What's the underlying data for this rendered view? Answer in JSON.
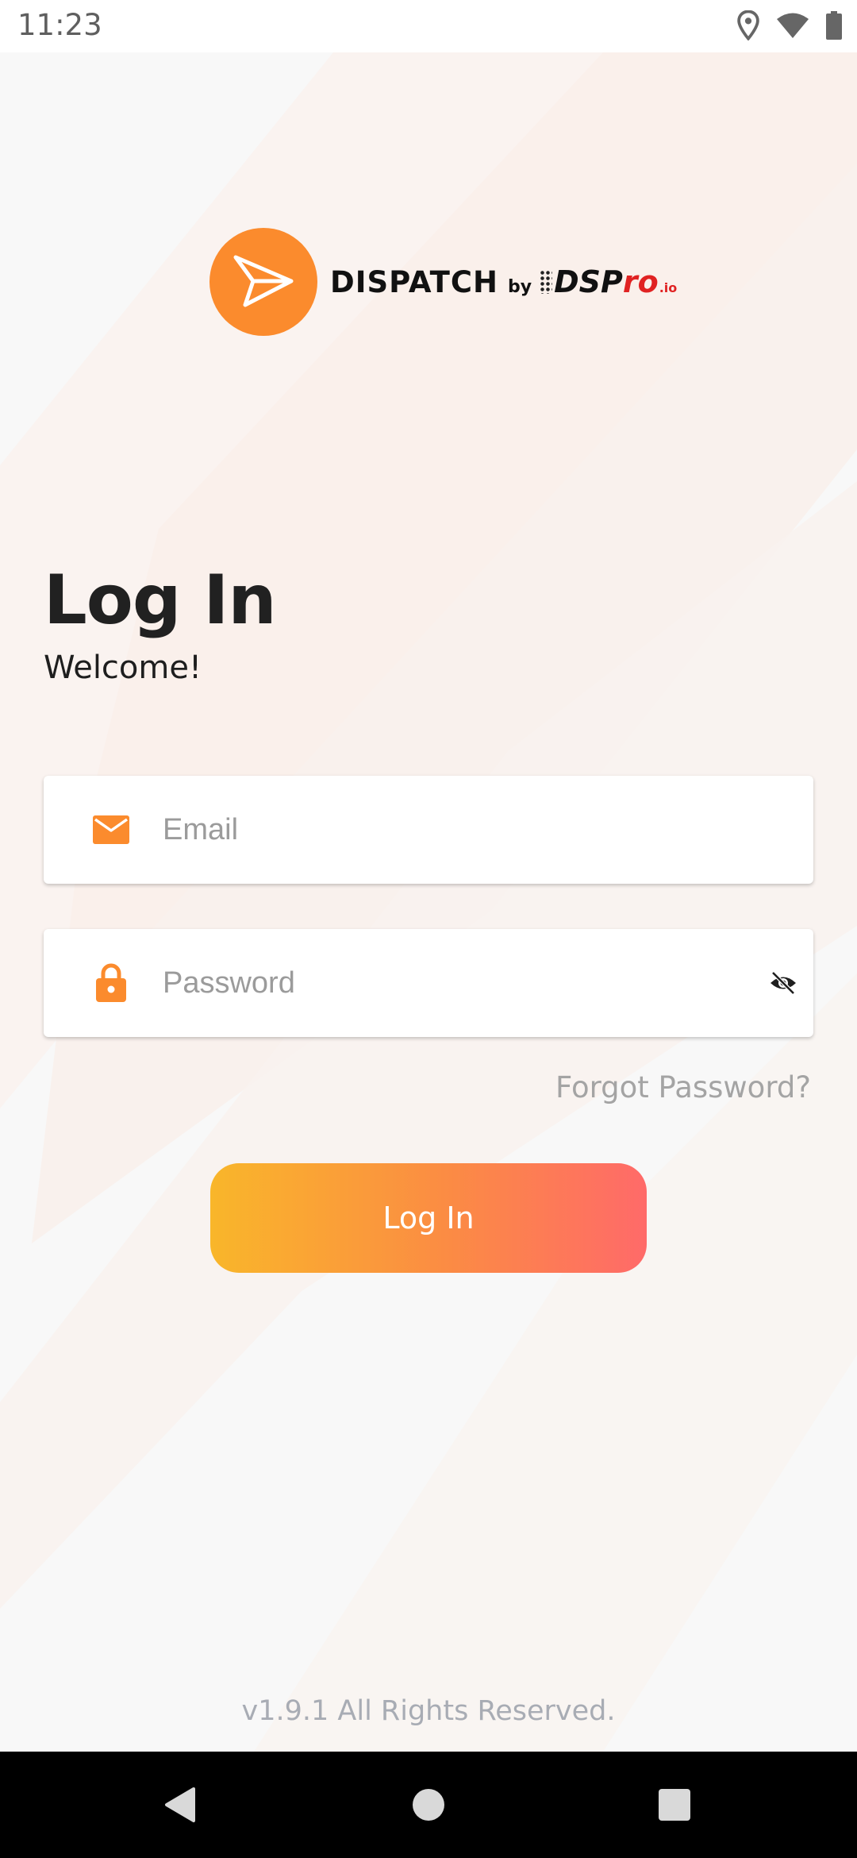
{
  "status_bar": {
    "time": "11:23",
    "icons": [
      "location-icon",
      "wifi-icon",
      "battery-icon"
    ]
  },
  "logo": {
    "product": "DISPATCH",
    "by": "by",
    "brand_main": "DSP",
    "brand_accent": "ro",
    "brand_sub": ".io",
    "icon": "send-arrow-icon"
  },
  "header": {
    "title": "Log In",
    "subtitle": "Welcome!"
  },
  "form": {
    "email_placeholder": "Email",
    "email_value": "",
    "email_icon": "mail-icon",
    "password_placeholder": "Password",
    "password_value": "",
    "password_icon": "lock-icon",
    "visibility_icon": "eye-off-icon",
    "forgot_label": "Forgot Password?",
    "submit_label": "Log In"
  },
  "footer": {
    "text": "v1.9.1 All Rights Reserved."
  },
  "nav": {
    "buttons": [
      "back-icon",
      "home-icon",
      "recents-icon"
    ]
  },
  "colors": {
    "accent": "#fb8b2d",
    "button_start": "#f9b62a",
    "button_end": "#ff6a69",
    "muted_text": "#a4a4a4"
  }
}
